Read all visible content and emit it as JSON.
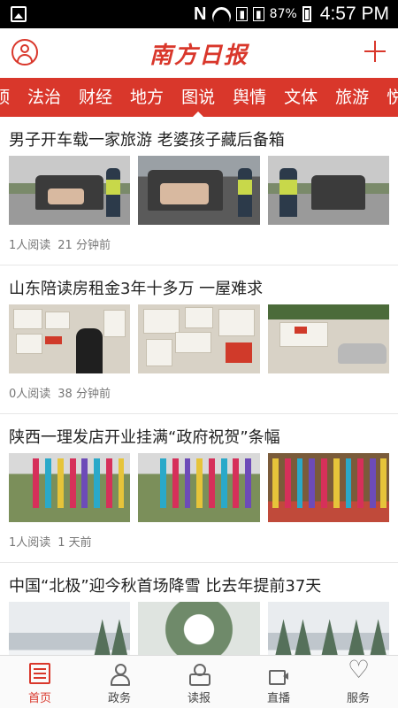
{
  "status_bar": {
    "battery": "87%",
    "time": "4:57 PM",
    "icons": [
      "image-icon",
      "n-icon",
      "wifi-icon",
      "signal-icon",
      "signal-icon",
      "battery-icon"
    ]
  },
  "header": {
    "logo": "南方日报",
    "left_icon": "user-avatar-icon",
    "right_icon": "plus-icon",
    "accent_color": "#d9372b"
  },
  "tabs": [
    {
      "label": "顶"
    },
    {
      "label": "法治"
    },
    {
      "label": "财经"
    },
    {
      "label": "地方"
    },
    {
      "label": "图说",
      "active": true
    },
    {
      "label": "舆情"
    },
    {
      "label": "文体"
    },
    {
      "label": "旅游"
    },
    {
      "label": "悦"
    }
  ],
  "articles": [
    {
      "title": "男子开车载一家旅游 老婆孩子藏后备箱",
      "reads": "1人阅读",
      "time": "21 分钟前"
    },
    {
      "title": "山东陪读房租金3年十多万 一屋难求",
      "reads": "0人阅读",
      "time": "38 分钟前"
    },
    {
      "title": "陕西一理发店开业挂满“政府祝贺”条幅",
      "reads": "1人阅读",
      "time": "1 天前"
    },
    {
      "title": "中国“北极”迎今秋首场降雪 比去年提前37天",
      "reads": "",
      "time": ""
    }
  ],
  "bottom_nav": [
    {
      "label": "首页",
      "icon": "news-icon",
      "active": true
    },
    {
      "label": "政务",
      "icon": "person-icon"
    },
    {
      "label": "读报",
      "icon": "reader-icon"
    },
    {
      "label": "直播",
      "icon": "video-camera-icon"
    },
    {
      "label": "服务",
      "icon": "heart-icon"
    }
  ]
}
